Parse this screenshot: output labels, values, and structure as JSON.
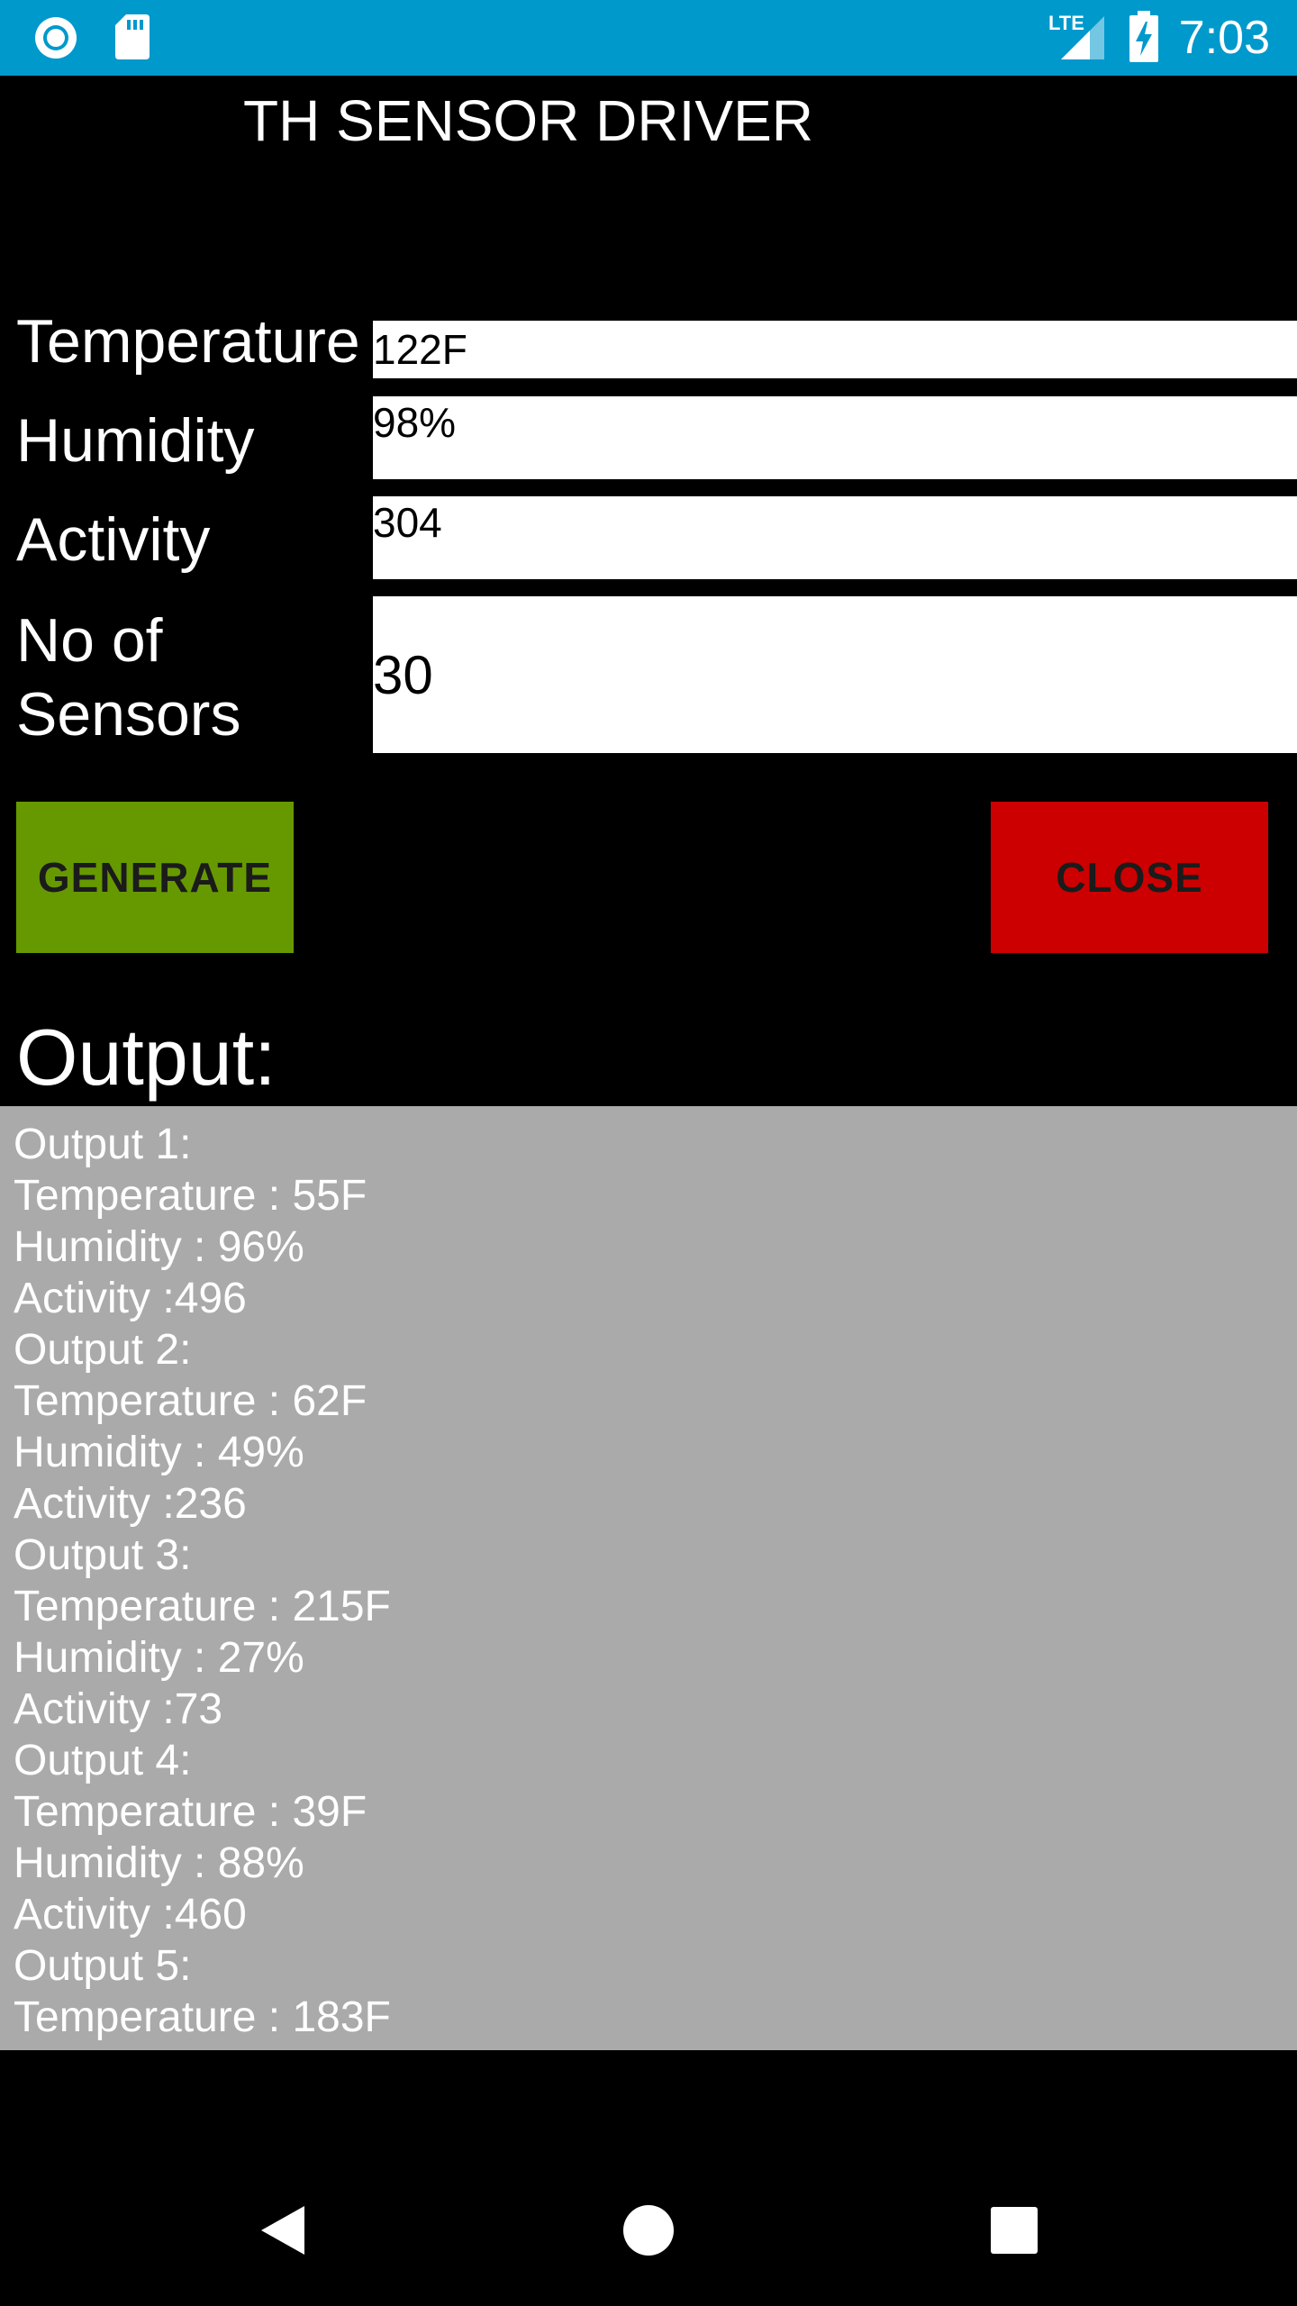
{
  "status_bar": {
    "time": "7:03",
    "network_label": "LTE",
    "icons": [
      "sync-icon",
      "sd-card-icon",
      "lte-signal-icon",
      "battery-charging-icon"
    ],
    "background": "#0099cc"
  },
  "app": {
    "title": "TH SENSOR DRIVER"
  },
  "form": {
    "temperature": {
      "label": "Temperature",
      "value": "122F"
    },
    "humidity": {
      "label": "Humidity",
      "value": "98%"
    },
    "activity": {
      "label": "Activity",
      "value": "304"
    },
    "sensors": {
      "label_line1": "No of",
      "label_line2": "Sensors",
      "value": "30"
    }
  },
  "buttons": {
    "generate": {
      "label": "GENERATE",
      "color": "#669900"
    },
    "close": {
      "label": "CLOSE",
      "color": "#cc0000"
    }
  },
  "output": {
    "heading": "Output:",
    "background": "#aaaaaa",
    "lines": [
      "Output 1:",
      "Temperature : 55F",
      "Humidity : 96%",
      "Activity :496",
      "Output 2:",
      "Temperature : 62F",
      "Humidity : 49%",
      "Activity :236",
      "Output 3:",
      "Temperature : 215F",
      "Humidity : 27%",
      "Activity :73",
      "Output 4:",
      "Temperature : 39F",
      "Humidity : 88%",
      "Activity :460",
      "Output 5:",
      "Temperature : 183F"
    ]
  },
  "nav_bar": {
    "buttons": [
      "back-icon",
      "home-icon",
      "recents-icon"
    ]
  }
}
